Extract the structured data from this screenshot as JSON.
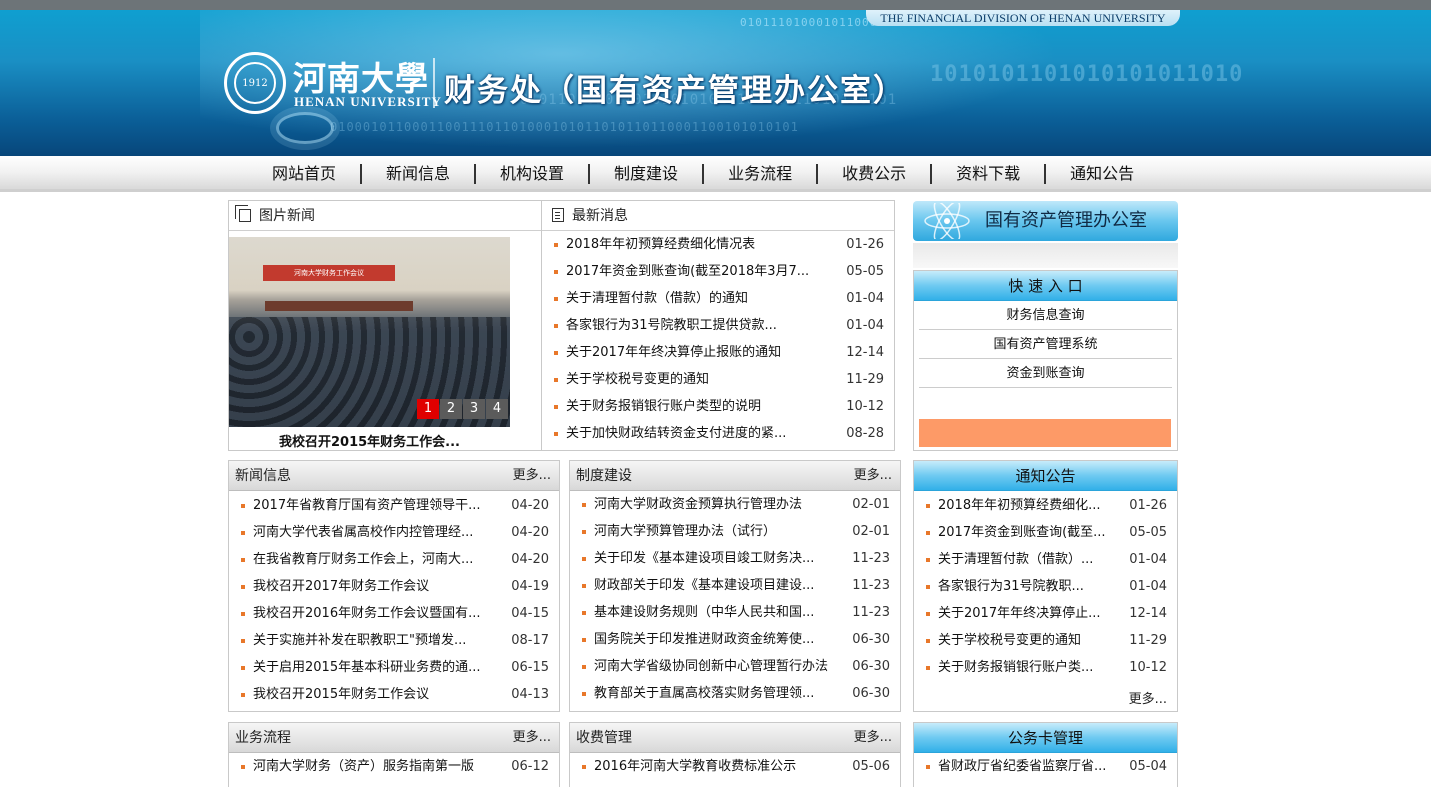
{
  "header": {
    "en_tag": "THE FINANCIAL DIVISION OF HENAN UNIVERSITY",
    "univ_cn": "河南大學",
    "univ_en": "HENAN UNIVERSITY",
    "seal_year": "1912",
    "dept_title": "财务处（国有资产管理办公室）",
    "binary_1": "0101110100010110001100110110101010101101011010111010",
    "binary_2": "1010101101010101011010",
    "binary_3": "0101101010110101010101110101011010110101",
    "binary_4": "010001011000110011101101000101011010110110001100101010101"
  },
  "nav": [
    "网站首页",
    "新闻信息",
    "机构设置",
    "制度建设",
    "业务流程",
    "收费公示",
    "资料下载",
    "通知公告"
  ],
  "picnews": {
    "title": "图片新闻",
    "caption": "我校召开2015年财务工作会...",
    "photo_banner": "河南大学财务工作会议",
    "pages": [
      "1",
      "2",
      "3",
      "4"
    ],
    "active_page": "1"
  },
  "latest": {
    "title": "最新消息",
    "items": [
      {
        "t": "2018年年初预算经费细化情况表",
        "d": "01-26"
      },
      {
        "t": "2017年资金到账查询(截至2018年3月7...",
        "d": "05-05"
      },
      {
        "t": "关于清理暂付款（借款）的通知",
        "d": "01-04"
      },
      {
        "t": "各家银行为31号院教职工提供贷款...",
        "d": "01-04"
      },
      {
        "t": "关于2017年年终决算停止报账的通知",
        "d": "12-14"
      },
      {
        "t": "关于学校税号变更的通知",
        "d": "11-29"
      },
      {
        "t": "关于财务报销银行账户类型的说明",
        "d": "10-12"
      },
      {
        "t": "关于加快财政结转资金支付进度的紧...",
        "d": "08-28"
      }
    ]
  },
  "office": {
    "title": "国有资产管理办公室"
  },
  "quick": {
    "title": "快 速 入 口",
    "items": [
      "财务信息查询",
      "国有资产管理系统",
      "资金到账查询"
    ]
  },
  "news": {
    "title": "新闻信息",
    "more": "更多...",
    "items": [
      {
        "t": "2017年省教育厅国有资产管理领导干...",
        "d": "04-20"
      },
      {
        "t": "河南大学代表省属高校作内控管理经...",
        "d": "04-20"
      },
      {
        "t": "在我省教育厅财务工作会上，河南大...",
        "d": "04-20"
      },
      {
        "t": "我校召开2017年财务工作会议",
        "d": "04-19"
      },
      {
        "t": "我校召开2016年财务工作会议暨国有...",
        "d": "04-15"
      },
      {
        "t": "关于实施并补发在职教职工\"预增发...",
        "d": "08-17"
      },
      {
        "t": "关于启用2015年基本科研业务费的通...",
        "d": "06-15"
      },
      {
        "t": "我校召开2015年财务工作会议",
        "d": "04-13"
      }
    ]
  },
  "rules": {
    "title": "制度建设",
    "more": "更多...",
    "items": [
      {
        "t": "河南大学财政资金预算执行管理办法",
        "d": "02-01"
      },
      {
        "t": "河南大学预算管理办法（试行）",
        "d": "02-01"
      },
      {
        "t": "关于印发《基本建设项目竣工财务决...",
        "d": "11-23"
      },
      {
        "t": "财政部关于印发《基本建设项目建设...",
        "d": "11-23"
      },
      {
        "t": "基本建设财务规则（中华人民共和国...",
        "d": "11-23"
      },
      {
        "t": "国务院关于印发推进财政资金统筹使...",
        "d": "06-30"
      },
      {
        "t": "河南大学省级协同创新中心管理暂行办法",
        "d": "06-30"
      },
      {
        "t": "教育部关于直属高校落实财务管理领...",
        "d": "06-30"
      }
    ]
  },
  "notice": {
    "title": "通知公告",
    "more": "更多...",
    "items": [
      {
        "t": "2018年年初预算经费细化...",
        "d": "01-26"
      },
      {
        "t": "2017年资金到账查询(截至...",
        "d": "05-05"
      },
      {
        "t": "关于清理暂付款（借款）...",
        "d": "01-04"
      },
      {
        "t": "各家银行为31号院教职...",
        "d": "01-04"
      },
      {
        "t": "关于2017年年终决算停止...",
        "d": "12-14"
      },
      {
        "t": "关于学校税号变更的通知",
        "d": "11-29"
      },
      {
        "t": "关于财务报销银行账户类...",
        "d": "10-12"
      }
    ]
  },
  "process": {
    "title": "业务流程",
    "more": "更多...",
    "items": [
      {
        "t": "河南大学财务（资产）服务指南第一版",
        "d": "06-12"
      }
    ]
  },
  "fees": {
    "title": "收费管理",
    "more": "更多...",
    "items": [
      {
        "t": "2016年河南大学教育收费标准公示",
        "d": "05-06"
      }
    ]
  },
  "card": {
    "title": "公务卡管理",
    "items": [
      {
        "t": "省财政厅省纪委省监察厅省...",
        "d": "05-04"
      }
    ]
  }
}
